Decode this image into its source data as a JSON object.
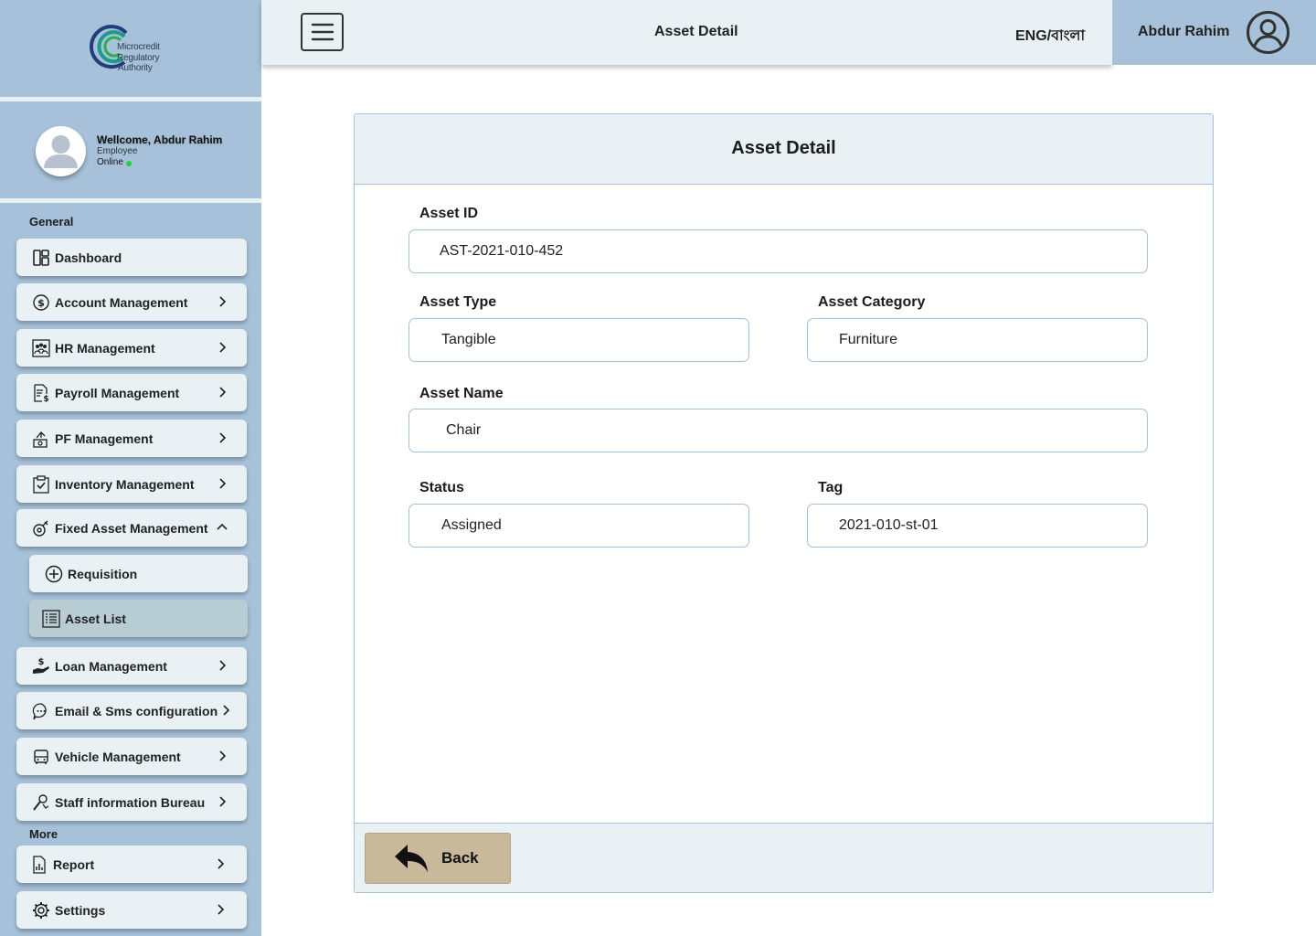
{
  "logo": {
    "line1": "Microcredit",
    "line2": "Regulatory",
    "line3": "Authority"
  },
  "profile": {
    "welcome": "Wellcome, Abdur Rahim",
    "role": "Employee",
    "status": "Online"
  },
  "sidebar": {
    "general_label": "General",
    "more_label": "More",
    "items": [
      {
        "label": "Dashboard"
      },
      {
        "label": "Account Management"
      },
      {
        "label": "HR Management"
      },
      {
        "label": "Payroll Management"
      },
      {
        "label": "PF Management"
      },
      {
        "label": "Inventory Management"
      },
      {
        "label": "Fixed Asset Management"
      },
      {
        "label": "Requisition"
      },
      {
        "label": "Asset List"
      },
      {
        "label": "Loan Management"
      },
      {
        "label": "Email & Sms configuration"
      },
      {
        "label": "Vehicle Management"
      },
      {
        "label": "Staff information Bureau"
      },
      {
        "label": "Report"
      },
      {
        "label": "Settings"
      }
    ]
  },
  "header": {
    "title": "Asset Detail",
    "language": "ENG/বাংলা",
    "username": "Abdur Rahim"
  },
  "card": {
    "title": "Asset Detail",
    "fields": {
      "asset_id": {
        "label": "Asset ID",
        "value": "AST-2021-010-452"
      },
      "asset_type": {
        "label": "Asset Type",
        "value": "Tangible"
      },
      "asset_category": {
        "label": "Asset Category",
        "value": "Furniture"
      },
      "asset_name": {
        "label": "Asset Name",
        "value": "Chair"
      },
      "status": {
        "label": "Status",
        "value": "Assigned"
      },
      "tag": {
        "label": "Tag",
        "value": "2021-010-st-01"
      }
    },
    "back_label": "Back"
  },
  "colors": {
    "sidebar_bg": "#a6c1d9",
    "panel_bg": "#e9f1f4",
    "back_button": "#c8b99a",
    "online": "#22d33b"
  }
}
